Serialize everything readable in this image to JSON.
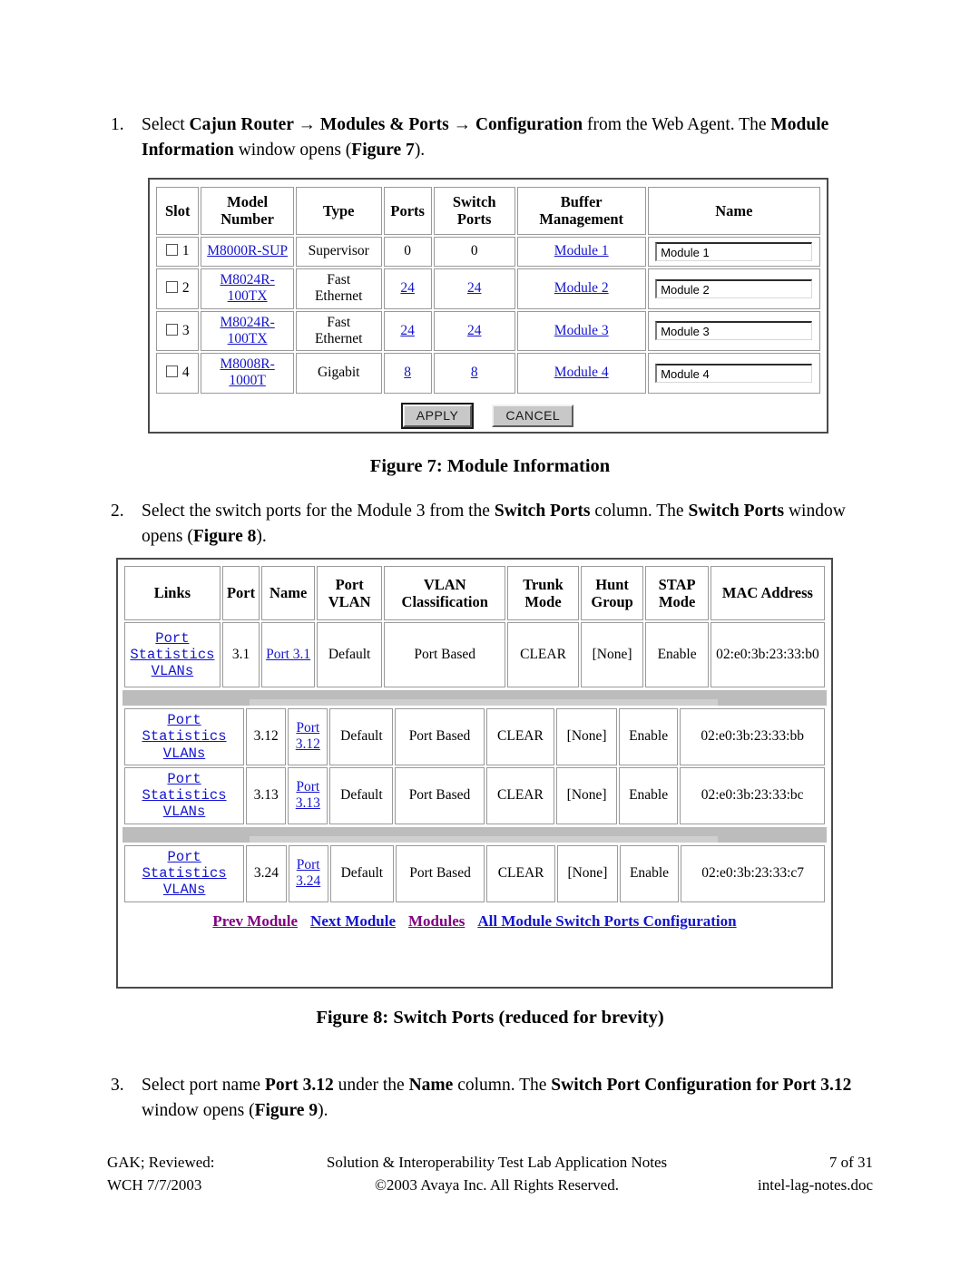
{
  "steps": [
    {
      "number": "1.",
      "segments": [
        {
          "t": "Select ",
          "b": false
        },
        {
          "t": "Cajun Router",
          "b": true
        },
        {
          "t": " → ",
          "b": true
        },
        {
          "t": "Modules & Ports",
          "b": true
        },
        {
          "t": " → ",
          "b": true
        },
        {
          "t": "Configuration",
          "b": true
        },
        {
          "t": " from the Web Agent.  The ",
          "b": false
        },
        {
          "t": "Module Information",
          "b": true
        },
        {
          "t": " window opens (",
          "b": false
        },
        {
          "t": "Figure 7",
          "b": true
        },
        {
          "t": ").",
          "b": false
        }
      ]
    },
    {
      "number": "2.",
      "segments": [
        {
          "t": "Select the switch ports for the Module 3 from the ",
          "b": false
        },
        {
          "t": "Switch Ports",
          "b": true
        },
        {
          "t": " column.  The ",
          "b": false
        },
        {
          "t": "Switch Ports",
          "b": true
        },
        {
          "t": " window opens (",
          "b": false
        },
        {
          "t": "Figure 8",
          "b": true
        },
        {
          "t": ").",
          "b": false
        }
      ]
    },
    {
      "number": "3.",
      "segments": [
        {
          "t": "Select port name ",
          "b": false
        },
        {
          "t": "Port 3.12",
          "b": true
        },
        {
          "t": " under the ",
          "b": false
        },
        {
          "t": "Name",
          "b": true
        },
        {
          "t": " column.  The ",
          "b": false
        },
        {
          "t": "Switch Port Configuration for Port 3.12",
          "b": true
        },
        {
          "t": " window opens (",
          "b": false
        },
        {
          "t": "Figure 9",
          "b": true
        },
        {
          "t": ").",
          "b": false
        }
      ]
    }
  ],
  "captions": {
    "figure7": "Figure 7: Module Information",
    "figure8": "Figure 8: Switch Ports (reduced for brevity)"
  },
  "module_information": {
    "headers": [
      "Slot",
      "Model Number",
      "Type",
      "Ports",
      "Switch Ports",
      "Buffer Management",
      "Name"
    ],
    "header_lines": {
      "slot": "Slot",
      "model_l1": "Model",
      "model_l2": "Number",
      "type": "Type",
      "ports": "Ports",
      "switchports_l1": "Switch",
      "switchports_l2": "Ports",
      "buffer_l1": "Buffer",
      "buffer_l2": "Management",
      "name": "Name"
    },
    "rows": [
      {
        "slot": "1",
        "model": "M8000R-SUP",
        "model_linked": true,
        "model_wrap": false,
        "model_l1": "M8000R-SUP",
        "model_l2": "",
        "type_l1": "Supervisor",
        "type_l2": "",
        "ports": "0",
        "ports_linked": false,
        "switch_ports": "0",
        "switch_ports_linked": false,
        "buffer": "Module 1",
        "name_value": "Module 1"
      },
      {
        "slot": "2",
        "model": "M8024R-100TX",
        "model_linked": true,
        "model_wrap": true,
        "model_l1": "M8024R-",
        "model_l2": "100TX",
        "type_l1": "Fast",
        "type_l2": "Ethernet",
        "ports": "24",
        "ports_linked": true,
        "switch_ports": "24",
        "switch_ports_linked": true,
        "buffer": "Module 2",
        "name_value": "Module 2"
      },
      {
        "slot": "3",
        "model": "M8024R-100TX",
        "model_linked": true,
        "model_wrap": true,
        "model_l1": "M8024R-",
        "model_l2": "100TX",
        "type_l1": "Fast",
        "type_l2": "Ethernet",
        "ports": "24",
        "ports_linked": true,
        "switch_ports": "24",
        "switch_ports_linked": true,
        "buffer": "Module 3",
        "name_value": "Module 3"
      },
      {
        "slot": "4",
        "model": "M8008R-1000T",
        "model_linked": true,
        "model_wrap": true,
        "model_l1": "M8008R-",
        "model_l2": "1000T",
        "type_l1": "Gigabit",
        "type_l2": "",
        "ports": "8",
        "ports_linked": true,
        "switch_ports": "8",
        "switch_ports_linked": true,
        "buffer": "Module 4",
        "name_value": "Module 4"
      }
    ],
    "buttons": {
      "apply": "APPLY",
      "cancel": "CANCEL"
    }
  },
  "switch_ports": {
    "headers": [
      "Links",
      "Port",
      "Name",
      "Port VLAN",
      "VLAN Classification",
      "Trunk Mode",
      "Hunt Group",
      "STAP Mode",
      "MAC Address"
    ],
    "header_lines": {
      "links": "Links",
      "port": "Port",
      "name": "Name",
      "portvlan_l1": "Port",
      "portvlan_l2": "VLAN",
      "vlancls_l1": "VLAN",
      "vlancls_l2": "Classification",
      "trunk_l1": "Trunk",
      "trunk_l2": "Mode",
      "hunt_l1": "Hunt",
      "hunt_l2": "Group",
      "stap_l1": "STAP",
      "stap_l2": "Mode",
      "mac": "MAC Address"
    },
    "link_labels": [
      "Port",
      "Statistics",
      "VLANs"
    ],
    "rows": [
      {
        "port": "3.1",
        "name": "Port 3.1",
        "name_l1": "Port 3.1",
        "name_l2": "",
        "port_vlan": "Default",
        "vlan_classification": "Port Based",
        "trunk_mode": "CLEAR",
        "hunt_group": "[None]",
        "stap_mode": "Enable",
        "mac_address": "02:e0:3b:23:33:b0"
      },
      {
        "port": "3.12",
        "name": "Port 3.12",
        "name_l1": "Port",
        "name_l2": "3.12",
        "port_vlan": "Default",
        "vlan_classification": "Port Based",
        "trunk_mode": "CLEAR",
        "hunt_group": "[None]",
        "stap_mode": "Enable",
        "mac_address": "02:e0:3b:23:33:bb"
      },
      {
        "port": "3.13",
        "name": "Port 3.13",
        "name_l1": "Port",
        "name_l2": "3.13",
        "port_vlan": "Default",
        "vlan_classification": "Port Based",
        "trunk_mode": "CLEAR",
        "hunt_group": "[None]",
        "stap_mode": "Enable",
        "mac_address": "02:e0:3b:23:33:bc"
      },
      {
        "port": "3.24",
        "name": "Port 3.24",
        "name_l1": "Port",
        "name_l2": "3.24",
        "port_vlan": "Default",
        "vlan_classification": "Port Based",
        "trunk_mode": "CLEAR",
        "hunt_group": "[None]",
        "stap_mode": "Enable",
        "mac_address": "02:e0:3b:23:33:c7"
      }
    ],
    "nav_links": [
      {
        "label": "Prev Module",
        "visited": true
      },
      {
        "label": "Next Module",
        "visited": false
      },
      {
        "label": "Modules",
        "visited": true
      },
      {
        "label": "All Module Switch Ports Configuration",
        "visited": false
      }
    ]
  },
  "footer": {
    "left_line1": "GAK; Reviewed:",
    "left_line2": "WCH 7/7/2003",
    "center_line1": "Solution & Interoperability Test Lab Application Notes",
    "center_line2": "©2003 Avaya Inc. All Rights Reserved.",
    "right_line1": "7 of 31",
    "right_line2": "intel-lag-notes.doc"
  },
  "colors": {
    "link": "#1414cf",
    "link_visited": "#800080",
    "frame_border": "#4a4a4a",
    "cell_border": "#9a9a9a",
    "button_face": "#c8c8c8",
    "separator_band": "#bcbcbc"
  }
}
